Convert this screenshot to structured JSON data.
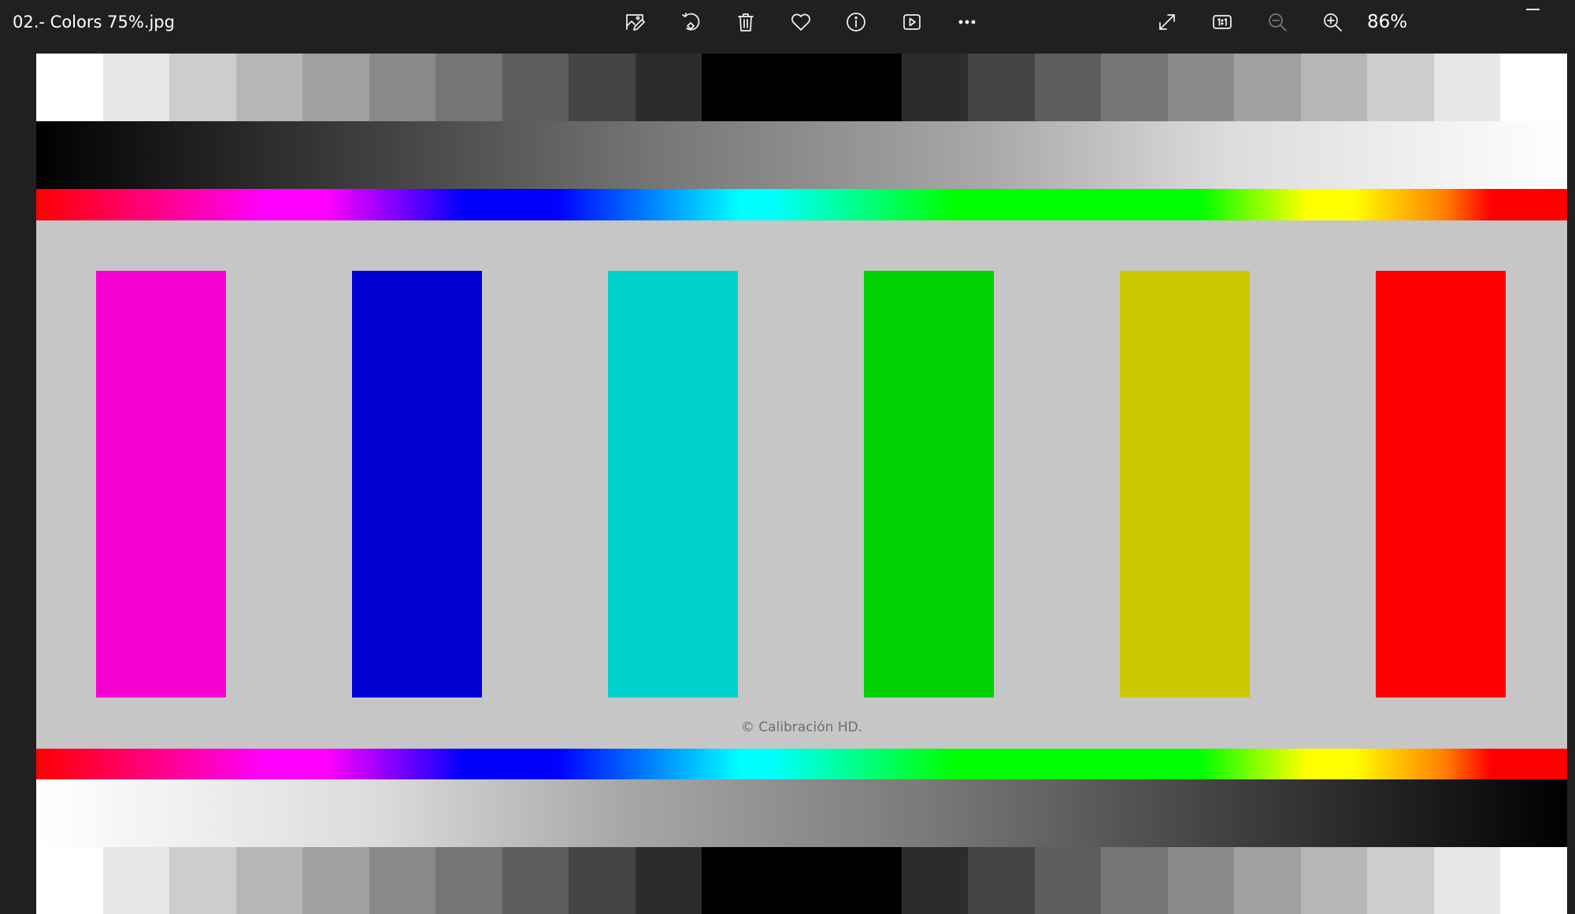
{
  "window": {
    "file_name": "02.- Colors 75%.jpg",
    "zoom_level": "86%"
  },
  "toolbar": {
    "buttons": [
      {
        "name": "edit-image-icon",
        "label": "Edit image"
      },
      {
        "name": "rotate-icon",
        "label": "Rotate"
      },
      {
        "name": "delete-icon",
        "label": "Delete"
      },
      {
        "name": "favorite-icon",
        "label": "Add to favorites"
      },
      {
        "name": "info-icon",
        "label": "File information"
      },
      {
        "name": "slideshow-icon",
        "label": "Start slideshow"
      },
      {
        "name": "more-icon",
        "label": "See more"
      },
      {
        "name": "fullscreen-icon",
        "label": "Full screen"
      },
      {
        "name": "actual-size-icon",
        "label": "Actual size"
      },
      {
        "name": "zoom-out-icon",
        "label": "Zoom out"
      },
      {
        "name": "zoom-in-icon",
        "label": "Zoom in"
      }
    ]
  },
  "image": {
    "credit": "© Calibración HD.",
    "gray_steps_top": [
      "#ffffff",
      "#e6e6e6",
      "#cdcdcd",
      "#b6b6b6",
      "#a0a0a0",
      "#8a8a8a",
      "#757575",
      "#5d5d5d",
      "#454545",
      "#2c2c2c",
      "#000000",
      "#000000",
      "#000000",
      "#2c2c2c",
      "#454545",
      "#5d5d5d",
      "#757575",
      "#8a8a8a",
      "#a0a0a0",
      "#b6b6b6",
      "#cdcdcd",
      "#e6e6e6",
      "#ffffff"
    ],
    "gray_steps_bottom": [
      "#ffffff",
      "#e6e6e6",
      "#cdcdcd",
      "#b6b6b6",
      "#a0a0a0",
      "#8a8a8a",
      "#757575",
      "#5d5d5d",
      "#454545",
      "#2c2c2c",
      "#000000",
      "#000000",
      "#000000",
      "#2c2c2c",
      "#454545",
      "#5d5d5d",
      "#757575",
      "#8a8a8a",
      "#a0a0a0",
      "#b6b6b6",
      "#cdcdcd",
      "#e6e6e6",
      "#ffffff"
    ],
    "background": "#c6c6c6",
    "color_bars": [
      {
        "name": "magenta",
        "color": "#f700d3"
      },
      {
        "name": "blue",
        "color": "#0000d4"
      },
      {
        "name": "cyan",
        "color": "#00d2cb"
      },
      {
        "name": "green",
        "color": "#00d100"
      },
      {
        "name": "yellow",
        "color": "#cdc800"
      },
      {
        "name": "red",
        "color": "#ff0000"
      }
    ]
  }
}
